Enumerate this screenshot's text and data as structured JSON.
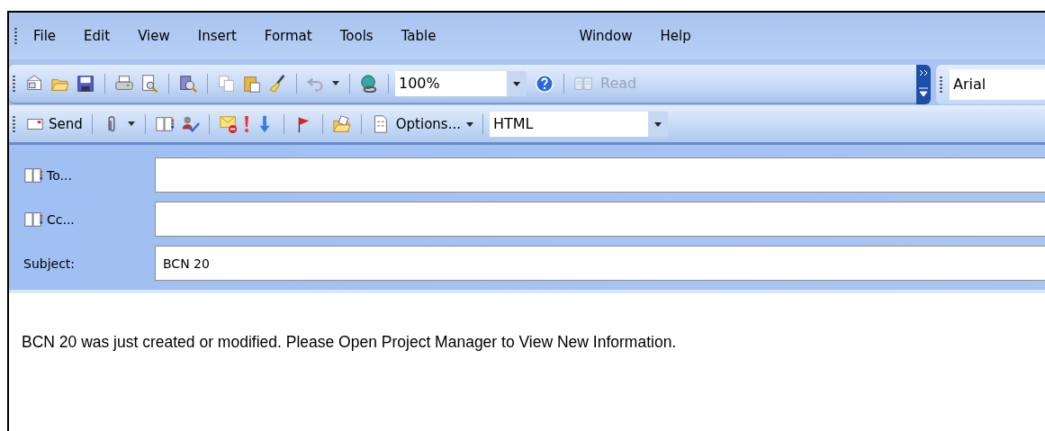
{
  "menu": [
    "File",
    "Edit",
    "View",
    "Insert",
    "Format",
    "Tools",
    "Table",
    "Window",
    "Help"
  ],
  "standard_toolbar": {
    "zoom": "100%",
    "read": {
      "label": "Read",
      "disabled": true
    },
    "font": "Arial"
  },
  "envelope_toolbar": {
    "send": "Send",
    "options": "Options...",
    "format": "HTML"
  },
  "header": [
    {
      "label": "To...",
      "kind": "book"
    },
    {
      "label": "Cc...",
      "kind": "book"
    },
    {
      "label": "Subject:",
      "kind": "plain",
      "value": "BCN 20"
    }
  ],
  "body": "BCN 20 was just created or modified. Please Open Project Manager to View New Information."
}
